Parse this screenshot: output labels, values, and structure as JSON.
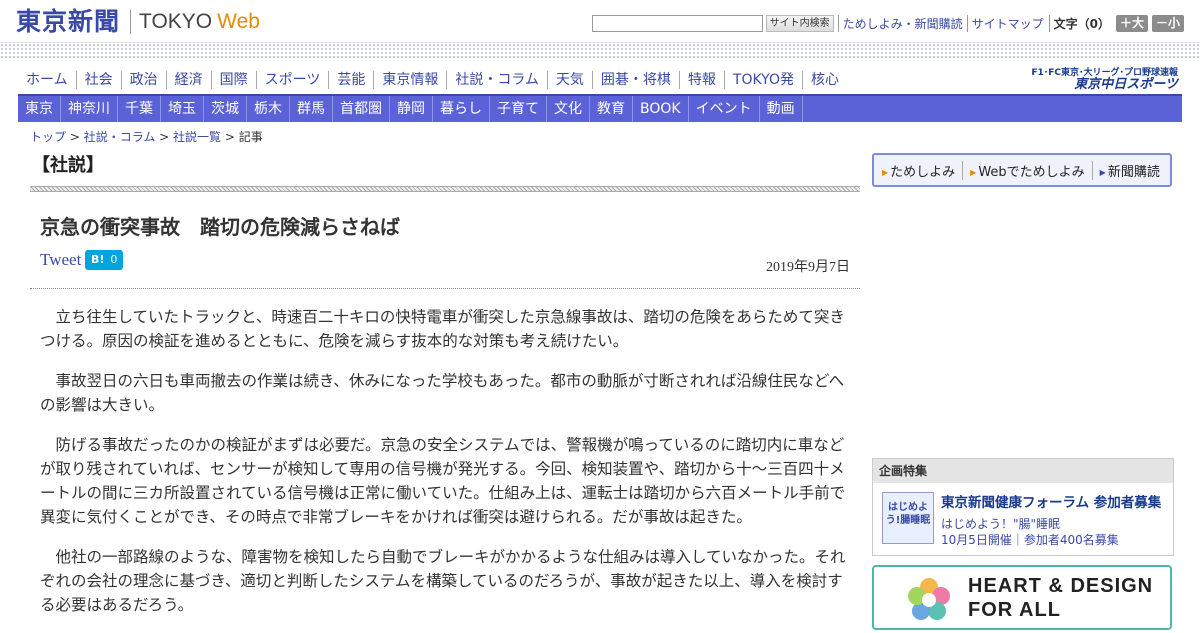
{
  "header": {
    "logo_jp": "東京新聞",
    "logo_tokyo": "TOKYO",
    "logo_web": "Web",
    "search_button": "サイト内検索",
    "links": [
      "ためしよみ・新聞購読",
      "サイトマップ"
    ],
    "font_size_label": "文字（0）",
    "font_bigger": "＋大",
    "font_smaller": "－小"
  },
  "sponichi": {
    "small": "F1･FC東京･大リーグ･プロ野球速報",
    "big": "東京中日スポーツ"
  },
  "nav_main": [
    "ホーム",
    "社会",
    "政治",
    "経済",
    "国際",
    "スポーツ",
    "芸能",
    "東京情報",
    "社説・コラム",
    "天気",
    "囲碁・将棋",
    "特報",
    "TOKYO発",
    "核心"
  ],
  "nav_sub": [
    "東京",
    "神奈川",
    "千葉",
    "埼玉",
    "茨城",
    "栃木",
    "群馬",
    "首都圏",
    "静岡",
    "暮らし",
    "子育て",
    "文化",
    "教育",
    "BOOK",
    "イベント",
    "動画"
  ],
  "breadcrumb": [
    "トップ",
    "社説・コラム",
    "社説一覧",
    "記事"
  ],
  "article": {
    "section": "【社説】",
    "headline": "京急の衝突事故　踏切の危険減らさねば",
    "tweet": "Tweet",
    "hatena_label": "B!",
    "hatena_count": "0",
    "date": "2019年9月7日",
    "paragraphs": [
      "立ち往生していたトラックと、時速百二十キロの快特電車が衝突した京急線事故は、踏切の危険をあらためて突きつける。原因の検証を進めるとともに、危険を減らす抜本的な対策も考え続けたい。",
      "事故翌日の六日も車両撤去の作業は続き、休みになった学校もあった。都市の動脈が寸断されれば沿線住民などへの影響は大きい。",
      "防げる事故だったのかの検証がまずは必要だ。京急の安全システムでは、警報機が鳴っているのに踏切内に車などが取り残されていれば、センサーが検知して専用の信号機が発光する。今回、検知装置や、踏切から十～三百四十メートルの間に三カ所設置されている信号機は正常に働いていた。仕組み上は、運転士は踏切から六百メートル手前で異変に気付くことができ、その時点で非常ブレーキをかければ衝突は避けられる。だが事故は起きた。",
      "他社の一部路線のような、障害物を検知したら自動でブレーキがかかるような仕組みは導入していなかった。それぞれの会社の理念に基づき、適切と判断したシステムを構築しているのだろうが、事故が起きた以上、導入を検討する必要はあるだろう。"
    ]
  },
  "sidebar": {
    "trial_links": [
      "ためしよみ",
      "Webでためしよみ",
      "新聞購読"
    ],
    "feature": {
      "heading": "企画特集",
      "thumb_text": "はじめよう!腸睡眠",
      "title": "東京新聞健康フォーラム 参加者募集",
      "subtitle": "はじめよう！\"腸\"睡眠",
      "info": "10月5日開催｜参加者400名募集"
    },
    "banner_line1": "HEART & DESIGN",
    "banner_line2": "FOR ALL"
  }
}
